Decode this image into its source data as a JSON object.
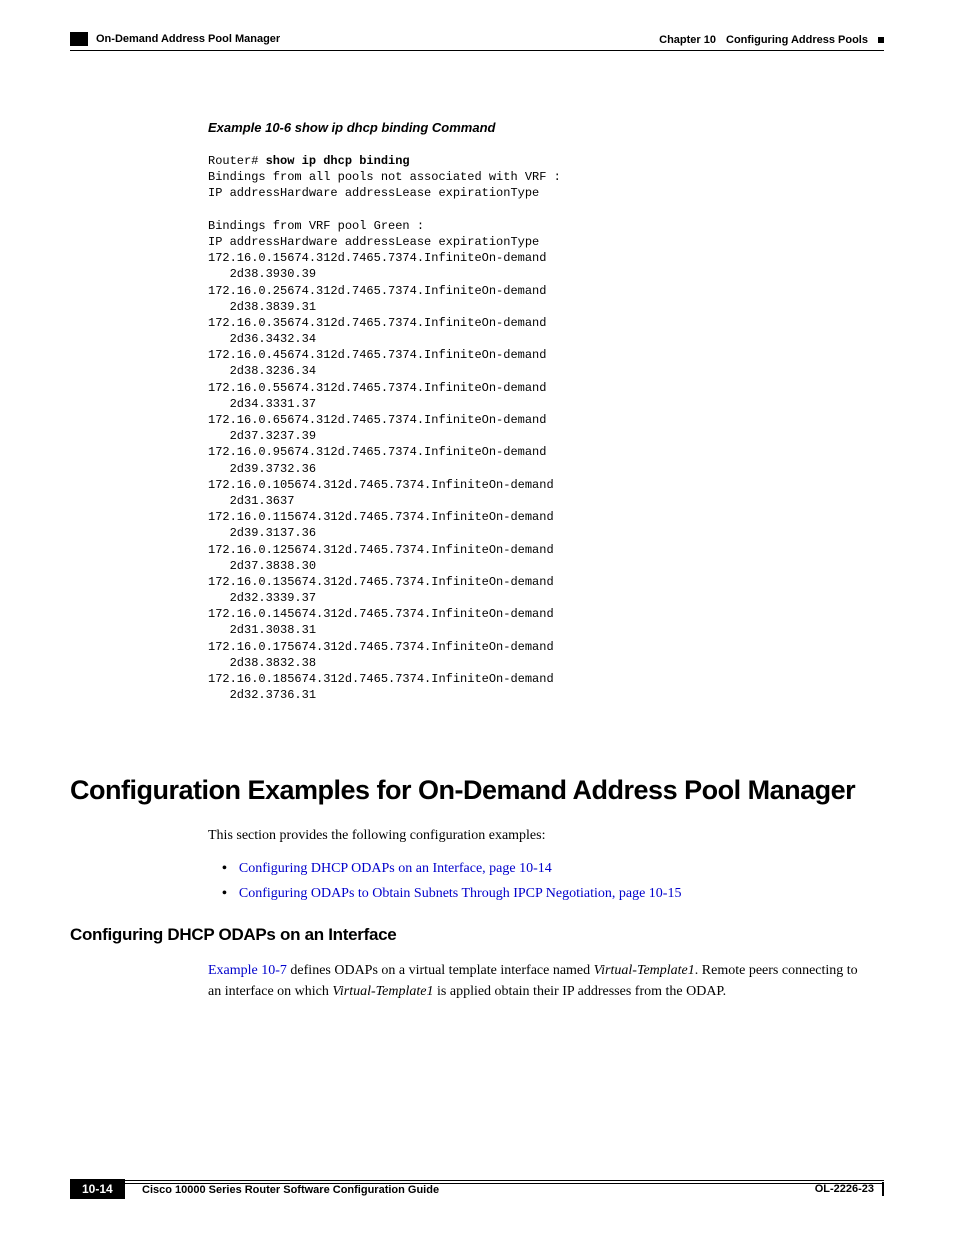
{
  "header": {
    "left_section": "On-Demand Address Pool Manager",
    "chapter_label": "Chapter 10",
    "chapter_title": "Configuring Address Pools"
  },
  "example": {
    "caption": "Example 10-6   show ip dhcp binding Command",
    "prompt": "Router# ",
    "command": "show ip dhcp binding",
    "output": "Bindings from all pools not associated with VRF :\nIP addressHardware addressLease expirationType\n\nBindings from VRF pool Green :\nIP addressHardware addressLease expirationType\n172.16.0.15674.312d.7465.7374.InfiniteOn-demand\n   2d38.3930.39\n172.16.0.25674.312d.7465.7374.InfiniteOn-demand\n   2d38.3839.31\n172.16.0.35674.312d.7465.7374.InfiniteOn-demand\n   2d36.3432.34\n172.16.0.45674.312d.7465.7374.InfiniteOn-demand\n   2d38.3236.34\n172.16.0.55674.312d.7465.7374.InfiniteOn-demand\n   2d34.3331.37\n172.16.0.65674.312d.7465.7374.InfiniteOn-demand\n   2d37.3237.39\n172.16.0.95674.312d.7465.7374.InfiniteOn-demand\n   2d39.3732.36\n172.16.0.105674.312d.7465.7374.InfiniteOn-demand\n   2d31.3637\n172.16.0.115674.312d.7465.7374.InfiniteOn-demand\n   2d39.3137.36\n172.16.0.125674.312d.7465.7374.InfiniteOn-demand\n   2d37.3838.30\n172.16.0.135674.312d.7465.7374.InfiniteOn-demand\n   2d32.3339.37\n172.16.0.145674.312d.7465.7374.InfiniteOn-demand\n   2d31.3038.31\n172.16.0.175674.312d.7465.7374.InfiniteOn-demand\n   2d38.3832.38\n172.16.0.185674.312d.7465.7374.InfiniteOn-demand\n   2d32.3736.31"
  },
  "h1": "Configuration Examples for On-Demand Address Pool Manager",
  "intro": {
    "lead": "This section provides the following configuration examples:",
    "b1": "Configuring DHCP ODAPs on an Interface, page 10-14",
    "b2": "Configuring ODAPs to Obtain Subnets Through IPCP Negotiation, page 10-15"
  },
  "h2": "Configuring DHCP ODAPs on an Interface",
  "sub": {
    "link": "Example 10-7",
    "t1": " defines ODAPs on a virtual template interface named ",
    "vt1": "Virtual-Template1",
    "t2": ". Remote peers connecting to an interface on which ",
    "vt2": "Virtual-Template1",
    "t3": " is applied obtain their IP addresses from the ODAP."
  },
  "footer": {
    "guide": "Cisco 10000 Series Router Software Configuration Guide",
    "page": "10-14",
    "doc": "OL-2226-23"
  }
}
